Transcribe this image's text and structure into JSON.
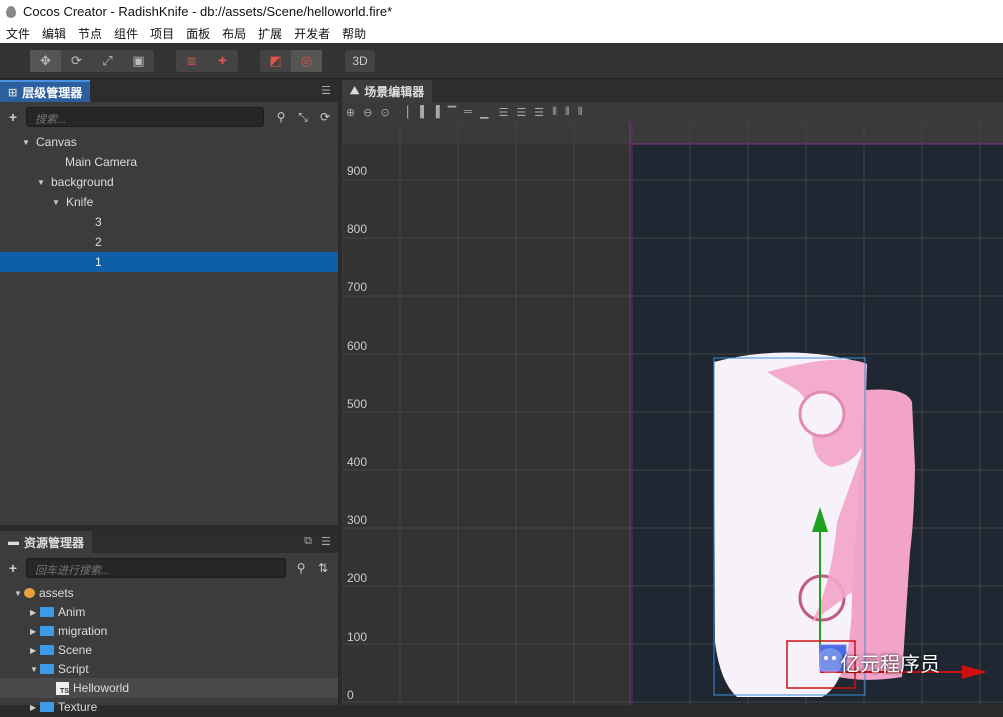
{
  "window": {
    "title": "Cocos Creator - RadishKnife - db://assets/Scene/helloworld.fire*"
  },
  "menu": [
    "文件",
    "编辑",
    "节点",
    "组件",
    "项目",
    "面板",
    "布局",
    "扩展",
    "开发者",
    "帮助"
  ],
  "toolbar": {
    "mode_3d_label": "3D"
  },
  "hierarchy": {
    "tab_label": "层级管理器",
    "search_placeholder": "搜索...",
    "nodes": [
      {
        "label": "Canvas",
        "depth": 1,
        "expanded": true,
        "selected": false
      },
      {
        "label": "Main Camera",
        "depth": 2,
        "expanded": null,
        "selected": false
      },
      {
        "label": "background",
        "depth": 2,
        "expanded": true,
        "selected": false
      },
      {
        "label": "Knife",
        "depth": 3,
        "expanded": true,
        "selected": false
      },
      {
        "label": "3",
        "depth": 4,
        "expanded": null,
        "selected": false
      },
      {
        "label": "2",
        "depth": 4,
        "expanded": null,
        "selected": false
      },
      {
        "label": "1",
        "depth": 4,
        "expanded": null,
        "selected": true
      }
    ]
  },
  "assets": {
    "tab_label": "资源管理器",
    "search_placeholder": "回车进行搜索...",
    "items": [
      {
        "label": "assets",
        "type": "db",
        "depth": 0,
        "expanded": true
      },
      {
        "label": "Anim",
        "type": "folder",
        "depth": 1,
        "expanded": false
      },
      {
        "label": "migration",
        "type": "folder",
        "depth": 1,
        "expanded": false
      },
      {
        "label": "Scene",
        "type": "folder",
        "depth": 1,
        "expanded": false
      },
      {
        "label": "Script",
        "type": "folder",
        "depth": 1,
        "expanded": true
      },
      {
        "label": "Helloworld",
        "type": "ts",
        "depth": 2,
        "expanded": null
      },
      {
        "label": "Texture",
        "type": "folder",
        "depth": 1,
        "expanded": false
      }
    ]
  },
  "scene": {
    "tab_label": "场景编辑器",
    "y_ruler_labels": [
      "900",
      "800",
      "700",
      "600",
      "500",
      "400",
      "300",
      "200",
      "100",
      "0"
    ],
    "watermark_text": "亿元程序员"
  },
  "colors": {
    "selection_blue": "#0e5ea8",
    "canvas_border": "#8a2b8a",
    "gizmo_green": "#1fa31f",
    "gizmo_red": "#cc1111"
  }
}
